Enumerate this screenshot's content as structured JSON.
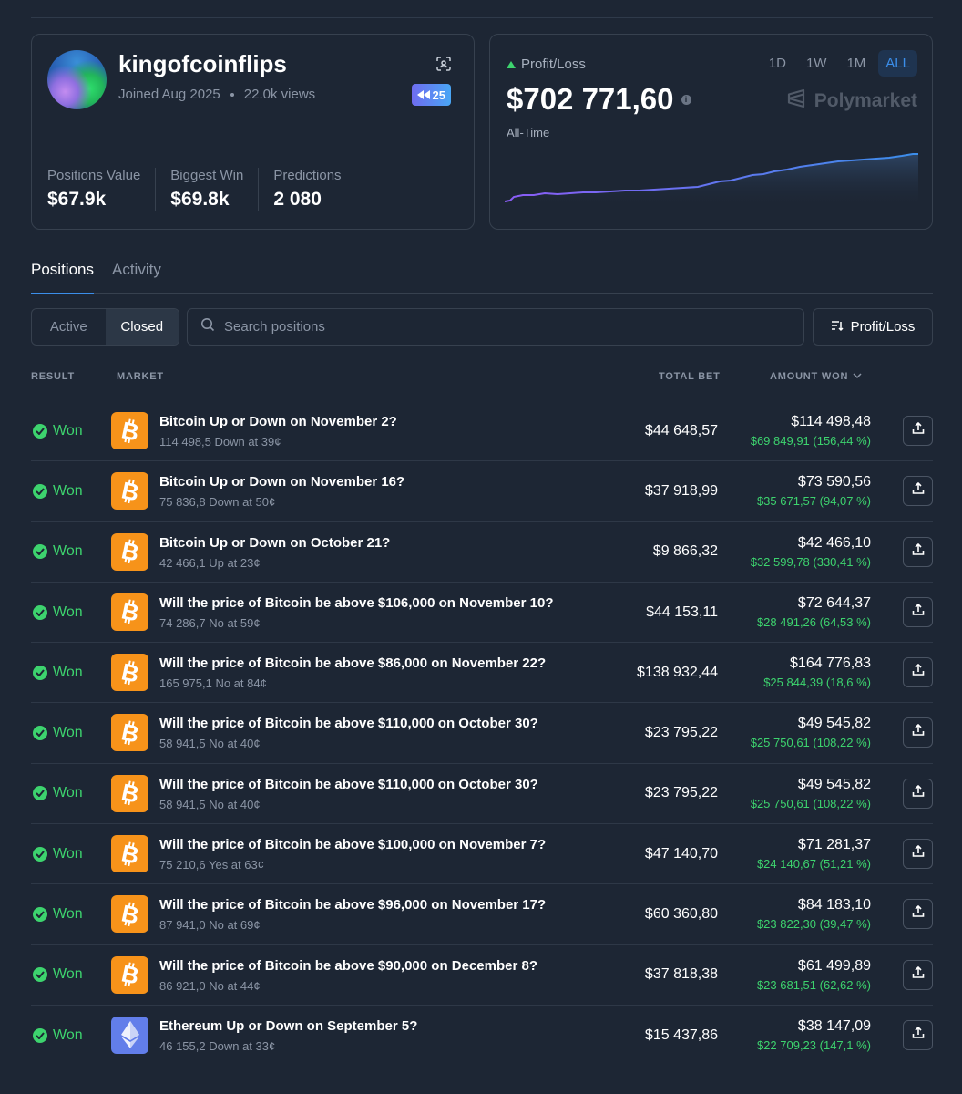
{
  "profile": {
    "username": "kingofcoinflips",
    "joined": "Joined Aug 2025",
    "views": "22.0k views",
    "badge": "25",
    "stats": [
      {
        "label": "Positions Value",
        "value": "$67.9k"
      },
      {
        "label": "Biggest Win",
        "value": "$69.8k"
      },
      {
        "label": "Predictions",
        "value": "2 080"
      }
    ]
  },
  "pnl": {
    "label": "Profit/Loss",
    "value": "$702 771,60",
    "period": "All-Time",
    "ranges": [
      "1D",
      "1W",
      "1M",
      "ALL"
    ],
    "active_range": "ALL",
    "brand": "Polymarket",
    "colors": {
      "line_start": "#8b5cf6",
      "line_end": "#3b8eea",
      "positive": "#3dd36e"
    }
  },
  "tabs": [
    "Positions",
    "Activity"
  ],
  "filters": {
    "active": "Active",
    "closed": "Closed"
  },
  "search": {
    "placeholder": "Search positions"
  },
  "sort_label": "Profit/Loss",
  "table": {
    "headers": {
      "result": "RESULT",
      "market": "MARKET",
      "total_bet": "TOTAL BET",
      "amount_won": "AMOUNT WON"
    },
    "rows": [
      {
        "result": "Won",
        "coin": "btc",
        "title": "Bitcoin Up or Down on November 2?",
        "sub": "114 498,5 Down at 39¢",
        "bet": "$44 648,57",
        "won": "$114 498,48",
        "gain": "$69 849,91 (156,44 %)"
      },
      {
        "result": "Won",
        "coin": "btc",
        "title": "Bitcoin Up or Down on November 16?",
        "sub": "75 836,8 Down at 50¢",
        "bet": "$37 918,99",
        "won": "$73 590,56",
        "gain": "$35 671,57 (94,07 %)"
      },
      {
        "result": "Won",
        "coin": "btc",
        "title": "Bitcoin Up or Down on October 21?",
        "sub": "42 466,1 Up at 23¢",
        "bet": "$9 866,32",
        "won": "$42 466,10",
        "gain": "$32 599,78 (330,41 %)"
      },
      {
        "result": "Won",
        "coin": "btc",
        "title": "Will the price of Bitcoin be above $106,000 on November 10?",
        "sub": "74 286,7 No at 59¢",
        "bet": "$44 153,11",
        "won": "$72 644,37",
        "gain": "$28 491,26 (64,53 %)"
      },
      {
        "result": "Won",
        "coin": "btc",
        "title": "Will the price of Bitcoin be above $86,000 on November 22?",
        "sub": "165 975,1 No at 84¢",
        "bet": "$138 932,44",
        "won": "$164 776,83",
        "gain": "$25 844,39 (18,6 %)"
      },
      {
        "result": "Won",
        "coin": "btc",
        "title": "Will the price of Bitcoin be above $110,000 on October 30?",
        "sub": "58 941,5 No at 40¢",
        "bet": "$23 795,22",
        "won": "$49 545,82",
        "gain": "$25 750,61 (108,22 %)"
      },
      {
        "result": "Won",
        "coin": "btc",
        "title": "Will the price of Bitcoin be above $110,000 on October 30?",
        "sub": "58 941,5 No at 40¢",
        "bet": "$23 795,22",
        "won": "$49 545,82",
        "gain": "$25 750,61 (108,22 %)"
      },
      {
        "result": "Won",
        "coin": "btc",
        "title": "Will the price of Bitcoin be above $100,000 on November 7?",
        "sub": "75 210,6 Yes at 63¢",
        "bet": "$47 140,70",
        "won": "$71 281,37",
        "gain": "$24 140,67 (51,21 %)"
      },
      {
        "result": "Won",
        "coin": "btc",
        "title": "Will the price of Bitcoin be above $96,000 on November 17?",
        "sub": "87 941,0 No at 69¢",
        "bet": "$60 360,80",
        "won": "$84 183,10",
        "gain": "$23 822,30 (39,47 %)"
      },
      {
        "result": "Won",
        "coin": "btc",
        "title": "Will the price of Bitcoin be above $90,000 on December 8?",
        "sub": "86 921,0 No at 44¢",
        "bet": "$37 818,38",
        "won": "$61 499,89",
        "gain": "$23 681,51 (62,62 %)"
      },
      {
        "result": "Won",
        "coin": "eth",
        "title": "Ethereum Up or Down on September 5?",
        "sub": "46 155,2 Down at 33¢",
        "bet": "$15 437,86",
        "won": "$38 147,09",
        "gain": "$22 709,23 (147,1 %)"
      }
    ]
  }
}
